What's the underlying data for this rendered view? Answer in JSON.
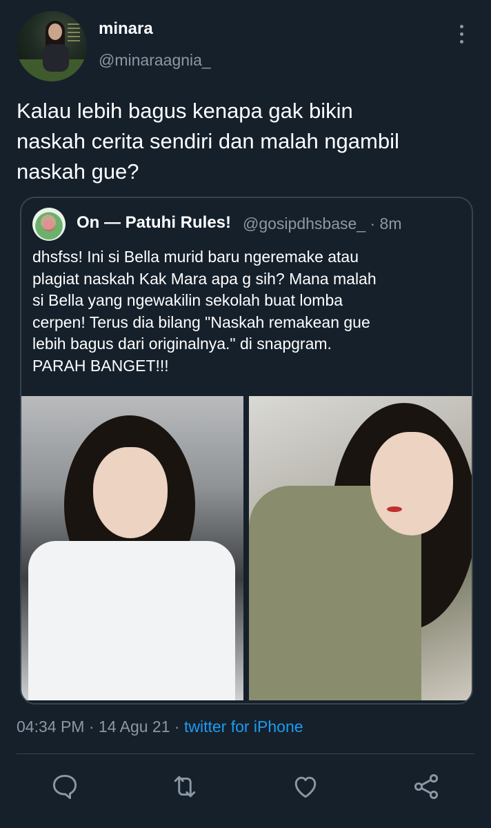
{
  "tweet": {
    "display_name": "minara",
    "handle": "@minaraagnia_",
    "text": "Kalau lebih bagus kenapa gak bikin\nnaskah cerita sendiri dan malah ngambil\nnaskah gue?",
    "time": "04:34 PM",
    "date": "14 Agu 21",
    "source": "twitter for iPhone",
    "separator": " · "
  },
  "quote": {
    "display_name": "On — Patuhi Rules!",
    "handle": "@gosipdhsbase_",
    "age": "8m",
    "text": "dhsfss!  Ini si Bella murid baru ngeremake atau\nplagiat naskah Kak Mara apa g sih? Mana malah\nsi Bella yang ngewakilin sekolah buat lomba\ncerpen! Terus dia bilang \"Naskah remakean gue\nlebih bagus dari originalnya.\" di snapgram.\nPARAH BANGET!!!"
  },
  "icons": {
    "more": "more-vertical-icon",
    "reply": "reply-icon",
    "retweet": "retweet-icon",
    "like": "heart-icon",
    "share": "share-icon"
  },
  "colors": {
    "background": "#15202b",
    "secondary_text": "#8b98a5",
    "link": "#1d9bf0",
    "border": "#38444d"
  }
}
